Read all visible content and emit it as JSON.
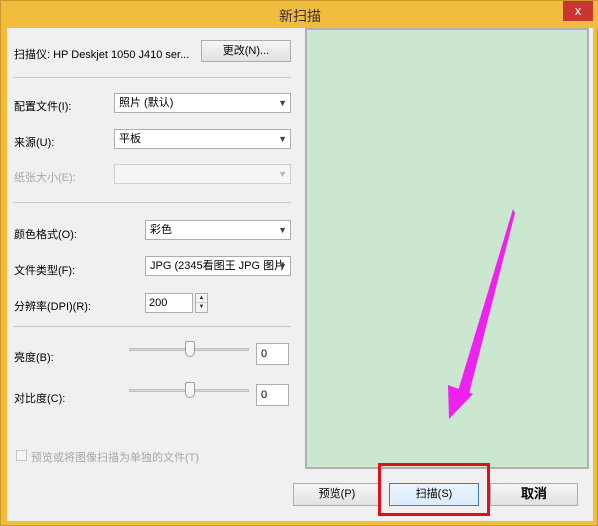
{
  "window": {
    "title": "新扫描",
    "close_label": "x"
  },
  "scanner": {
    "label": "扫描仪: HP Deskjet 1050 J410 ser...",
    "change_button": "更改(N)..."
  },
  "settings": {
    "profile_label": "配置文件(I):",
    "profile_value": "照片 (默认)",
    "source_label": "来源(U):",
    "source_value": "平板",
    "paper_size_label": "纸张大小(E):",
    "paper_size_value": "",
    "color_format_label": "颜色格式(O):",
    "color_format_value": "彩色",
    "file_type_label": "文件类型(F):",
    "file_type_value": "JPG (2345看图王 JPG 图片",
    "resolution_label": "分辨率(DPI)(R):",
    "resolution_value": "200",
    "brightness_label": "亮度(B):",
    "brightness_value": "0",
    "brightness_level": 0.5,
    "contrast_label": "对比度(C):",
    "contrast_value": "0",
    "contrast_level": 0.5,
    "separate_files_label": "预览或将图像扫描为单独的文件(T)",
    "separate_files_checked": false
  },
  "buttons": {
    "preview": "预览(P)",
    "scan": "扫描(S)",
    "cancel": "取消"
  },
  "colors": {
    "title_bar": "#f2bd3f",
    "close_button": "#c7372f",
    "preview_area": "#cce7cf",
    "annotation_arrow": "#ee22ee",
    "annotation_box": "#e0111e"
  },
  "icons": {
    "dropdown": "chevron-down-icon",
    "spin_up": "caret-up-icon",
    "spin_down": "caret-down-icon"
  }
}
